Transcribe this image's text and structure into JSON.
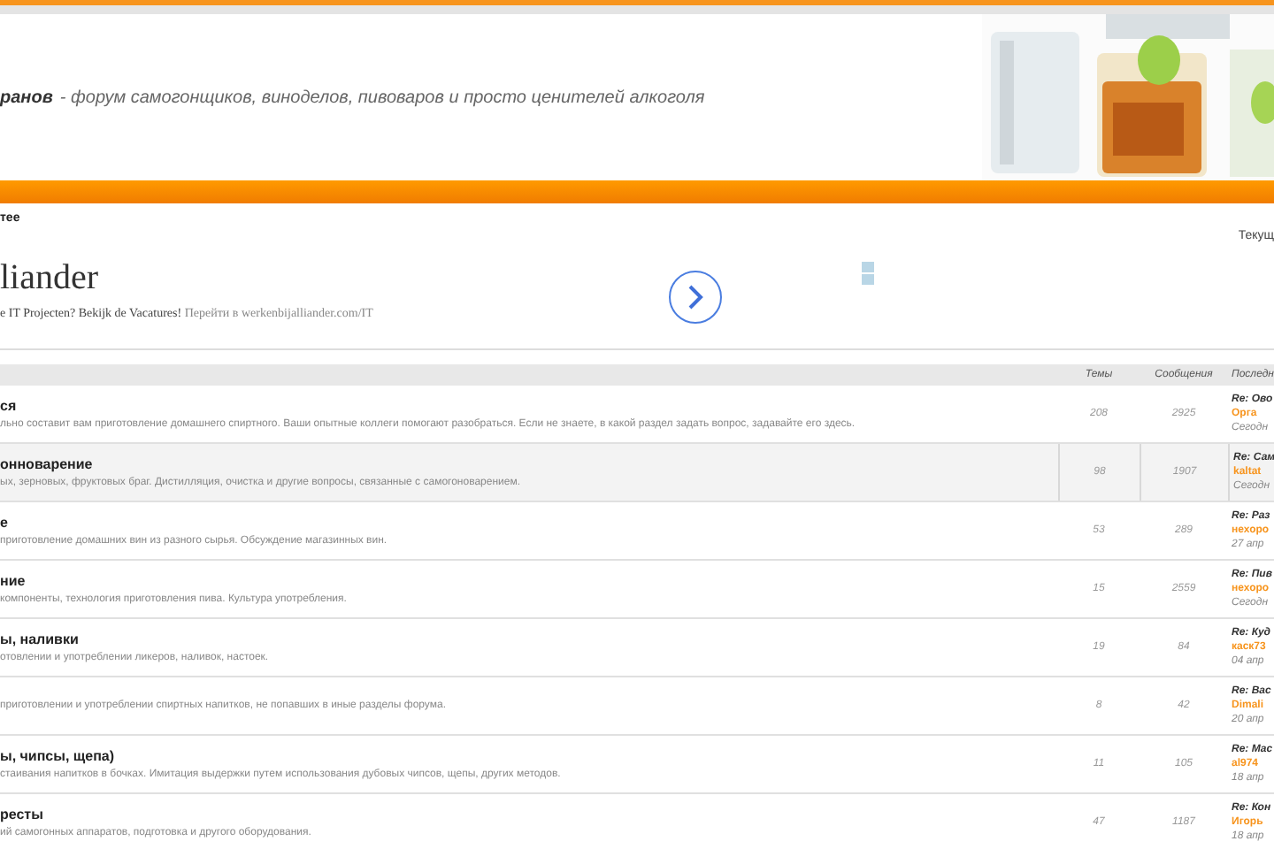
{
  "header": {
    "site_name": "ранов",
    "tagline": "- форум самогонщиков, виноделов, пивоваров и просто ценителей алкоголя"
  },
  "nav": {
    "breadcrumb": "тее",
    "time_label": "Текущ"
  },
  "ad": {
    "title": "liander",
    "text": "e IT Projecten? Bekijk de Vacatures!",
    "link": "Перейти в werkenbijalliander.com/IT"
  },
  "table": {
    "columns": [
      "Темы",
      "Сообщения",
      "Последн"
    ],
    "rows": [
      {
        "title": "ся",
        "description": "льно составит вам приготовление домашнего спиртного. Ваши опытные коллеги помогают разобраться. Если не знаете, в какой раздел задать вопрос, задавайте его здесь.",
        "topics": "208",
        "posts": "2925",
        "last_subject": "Re: Ово",
        "last_author": "Орга",
        "last_date": "Сегодн",
        "hovered": false
      },
      {
        "title": "онноварение",
        "description": "ых, зерновых, фруктовых браг. Дистилляция, очистка и другие вопросы, связанные с самогоноварением.",
        "topics": "98",
        "posts": "1907",
        "last_subject": "Re: Сам",
        "last_author": "kaltat",
        "last_date": "Сегодн",
        "hovered": true
      },
      {
        "title": "е",
        "description": "приготовление домашних вин из разного сырья. Обсуждение магазинных вин.",
        "topics": "53",
        "posts": "289",
        "last_subject": "Re: Раз",
        "last_author": "нехоро",
        "last_date": "27 апр",
        "hovered": false
      },
      {
        "title": "ние",
        "description": "компоненты, технология приготовления пива. Культура употребления.",
        "topics": "15",
        "posts": "2559",
        "last_subject": "Re: Пив",
        "last_author": "нехоро",
        "last_date": "Сегодн",
        "hovered": false
      },
      {
        "title": "ы, наливки",
        "description": "отовлении и употреблении ликеров, наливок, настоек.",
        "topics": "19",
        "posts": "84",
        "last_subject": "Re: Куд",
        "last_author": "каск73",
        "last_date": "04 апр",
        "hovered": false
      },
      {
        "description": "приготовлении и употреблении спиртных напитков, не попавших в иные разделы форума.",
        "topics": "8",
        "posts": "42",
        "last_subject": "Re: Вас",
        "last_author": "Dimali",
        "last_date": "20 апр",
        "hovered": false
      },
      {
        "title": "ы, чипсы, щепа)",
        "description": "стаивания напитков в бочках. Имитация выдержки путем использования дубовых чипсов, щепы, других методов.",
        "topics": "11",
        "posts": "105",
        "last_subject": "Re: Мас",
        "last_author": "al974",
        "last_date": "18 апр",
        "hovered": false
      },
      {
        "title": "ресты",
        "description": "ий самогонных аппаратов, подготовка и другого оборудования.",
        "topics": "47",
        "posts": "1187",
        "last_subject": "Re: Кон",
        "last_author": "Игорь",
        "last_date": "18 апр",
        "hovered": false
      }
    ]
  }
}
